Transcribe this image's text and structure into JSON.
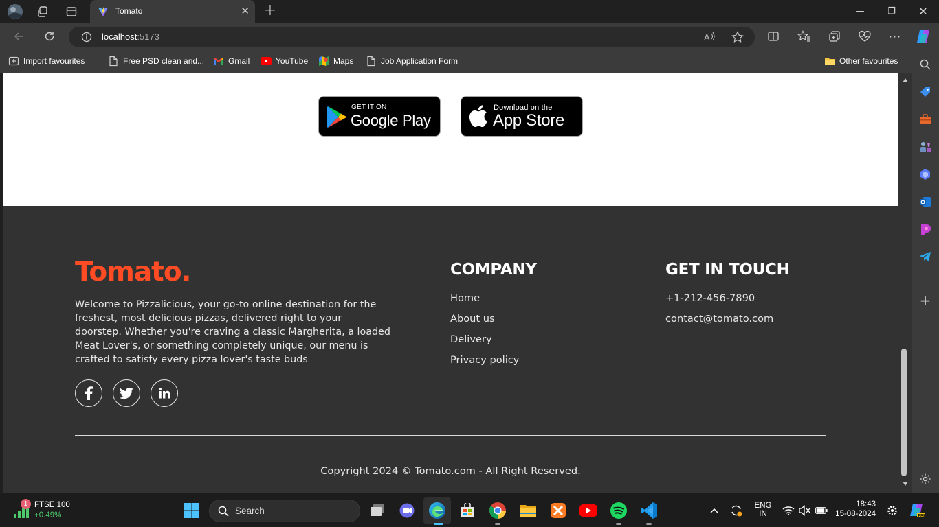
{
  "browser": {
    "tab_title": "Tomato",
    "url_host": "localhost",
    "url_port": ":5173",
    "bookmarks": [
      "Import favourites",
      "Free PSD clean and...",
      "Gmail",
      "YouTube",
      "Maps",
      "Job Application Form"
    ],
    "other_favourites": "Other favourites"
  },
  "page": {
    "app_download": {
      "google_play": {
        "small": "GET IT ON",
        "big": "Google Play"
      },
      "app_store": {
        "small": "Download on the",
        "big": "App Store"
      }
    },
    "footer": {
      "logo": "Tomato.",
      "description": "Welcome to Pizzalicious, your go-to online destination for the freshest, most delicious pizzas, delivered right to your doorstep. Whether you're craving a classic Margherita, a loaded Meat Lover's, or something completely unique, our menu is crafted to satisfy every pizza lover's taste buds",
      "social_icons": [
        "facebook-icon",
        "twitter-icon",
        "linkedin-icon"
      ],
      "company": {
        "heading": "COMPANY",
        "links": [
          "Home",
          "About us",
          "Delivery",
          "Privacy policy"
        ]
      },
      "contact": {
        "heading": "GET IN TOUCH",
        "phone": "+1-212-456-7890",
        "email": "contact@tomato.com"
      },
      "copyright": "Copyright 2024 © Tomato.com - All Right Reserved."
    }
  },
  "taskbar": {
    "widget": {
      "badge": "1",
      "name": "FTSE 100",
      "change": "+0.49%"
    },
    "search_label": "Search",
    "language": {
      "line1": "ENG",
      "line2": "IN"
    },
    "clock": {
      "time": "18:43",
      "date": "15-08-2024"
    }
  },
  "colors": {
    "brand": "#ff4c24",
    "footer_bg": "#323232",
    "ftse_change": "#4ec96c"
  }
}
